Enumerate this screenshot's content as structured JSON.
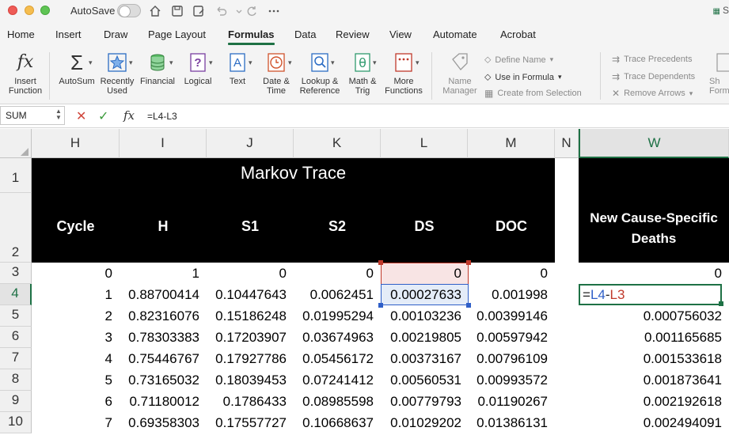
{
  "titlebar": {
    "autosave_label": "AutoSave",
    "right_fragment": "S"
  },
  "tabs": [
    "Home",
    "Insert",
    "Draw",
    "Page Layout",
    "Formulas",
    "Data",
    "Review",
    "View",
    "Automate",
    "Acrobat"
  ],
  "active_tab": "Formulas",
  "ribbon": {
    "insert_function": "Insert\nFunction",
    "autosum": "AutoSum",
    "recently_used": "Recently\nUsed",
    "financial": "Financial",
    "logical": "Logical",
    "text": "Text",
    "date_time": "Date &\nTime",
    "lookup_reference": "Lookup &\nReference",
    "math_trig": "Math &\nTrig",
    "more_functions": "More\nFunctions",
    "name_manager": "Name\nManager",
    "define_name": "Define Name",
    "use_in_formula": "Use in Formula",
    "create_from_selection": "Create from Selection",
    "trace_precedents": "Trace Precedents",
    "trace_dependents": "Trace Dependents",
    "remove_arrows": "Remove Arrows",
    "show_formulas_fragment": "Sh\nForm"
  },
  "formula_bar": {
    "name_box": "SUM",
    "formula": "=L4-L3",
    "fx": "fx"
  },
  "sheet": {
    "columns": [
      "H",
      "I",
      "J",
      "K",
      "L",
      "M",
      "N",
      "W"
    ],
    "rows": [
      "1",
      "2",
      "3",
      "4",
      "5",
      "6",
      "7",
      "8",
      "9",
      "10"
    ],
    "header_title": "Markov Trace",
    "header_labels": [
      "Cycle",
      "H",
      "S1",
      "S2",
      "DS",
      "DOC"
    ],
    "w_header": "New Cause-Specific Deaths",
    "data": [
      [
        "0",
        "1",
        "0",
        "0",
        "0",
        "0"
      ],
      [
        "1",
        "0.88700414",
        "0.10447643",
        "0.0062451",
        "0.00027633",
        "0.001998"
      ],
      [
        "2",
        "0.82316076",
        "0.15186248",
        "0.01995294",
        "0.00103236",
        "0.00399146"
      ],
      [
        "3",
        "0.78303383",
        "0.17203907",
        "0.03674963",
        "0.00219805",
        "0.00597942"
      ],
      [
        "4",
        "0.75446767",
        "0.17927786",
        "0.05456172",
        "0.00373167",
        "0.00796109"
      ],
      [
        "5",
        "0.73165032",
        "0.18039453",
        "0.07241412",
        "0.00560531",
        "0.00993572"
      ],
      [
        "6",
        "0.71180012",
        "0.1786433",
        "0.08985598",
        "0.00779793",
        "0.01190267"
      ],
      [
        "7",
        "0.69358303",
        "0.17557727",
        "0.10668637",
        "0.01029202",
        "0.01386131"
      ]
    ],
    "w_values": [
      "0",
      "",
      "0.000756032",
      "0.001165685",
      "0.001533618",
      "0.001873641",
      "0.002192618",
      "0.002494091"
    ],
    "editing_formula": {
      "prefix": "=",
      "ref1": "L4",
      "op": "-",
      "ref2": "L3"
    },
    "colors": {
      "ref1": "#2f5fc8",
      "ref2": "#c0392b",
      "selection": "#1e7145"
    }
  }
}
